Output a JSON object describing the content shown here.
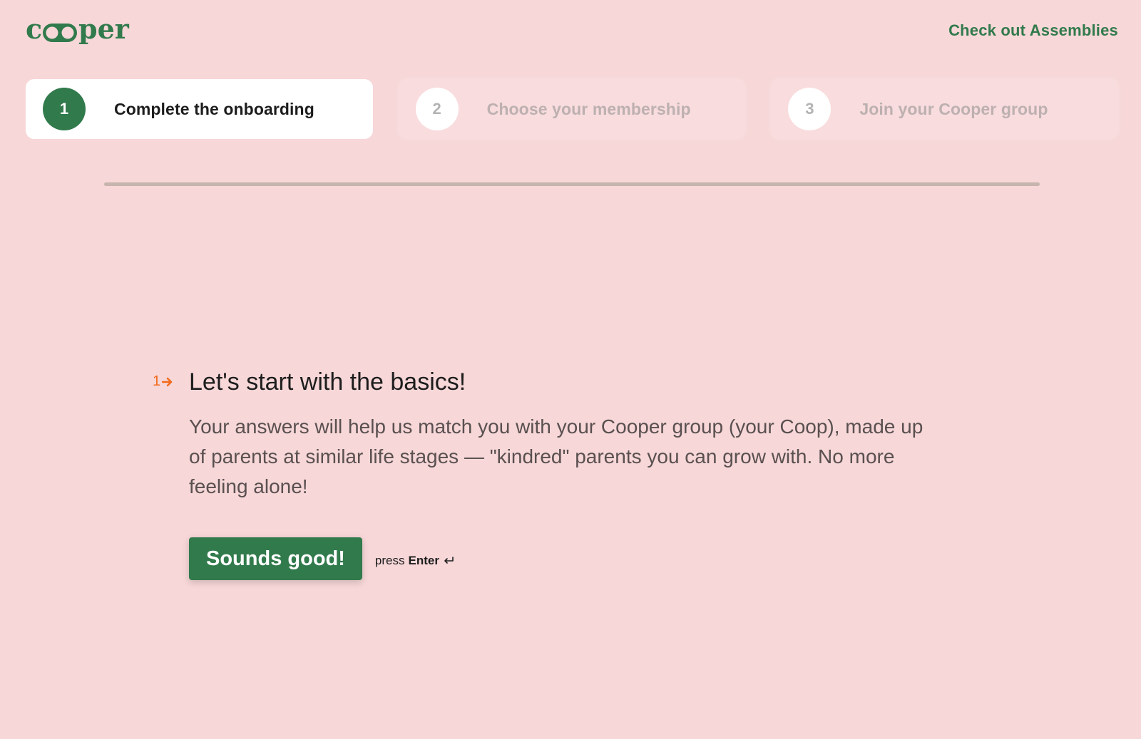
{
  "header": {
    "logo_text": "cooper",
    "link_label": "Check out Assemblies"
  },
  "steps": [
    {
      "number": "1",
      "label": "Complete the onboarding",
      "state": "active"
    },
    {
      "number": "2",
      "label": "Choose your membership",
      "state": "inactive"
    },
    {
      "number": "3",
      "label": "Join your Cooper group",
      "state": "inactive"
    }
  ],
  "progress": {
    "fraction": 0
  },
  "question": {
    "index": "1",
    "index_icon": "arrow-right-icon",
    "title": "Let's start with the basics!",
    "description": "Your answers will help us match you with your Cooper group (your Coop), made up of parents at similar life stages — \"kindred\" parents you can grow with. No more feeling alone!",
    "button_label": "Sounds good!",
    "hint_prefix": "press",
    "hint_key": "Enter",
    "hint_icon": "enter-return-icon"
  },
  "colors": {
    "background": "#f7d7d8",
    "brand_green": "#317a4c",
    "accent_orange": "#f26a1b"
  }
}
